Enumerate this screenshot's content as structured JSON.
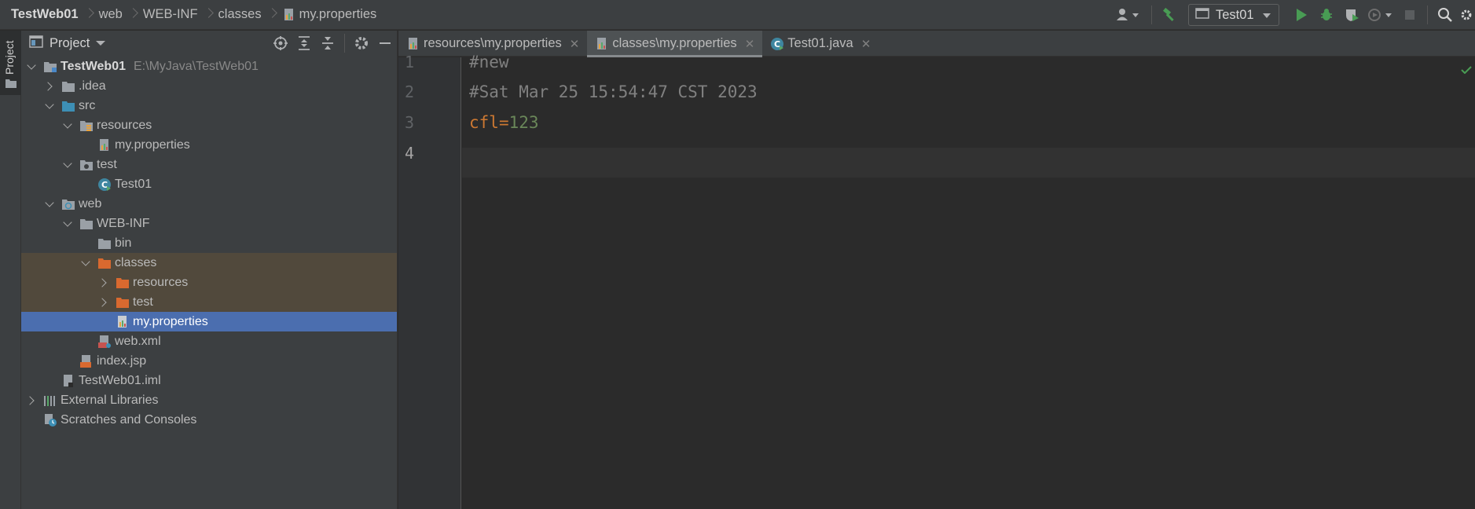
{
  "breadcrumbs": [
    "TestWeb01",
    "web",
    "WEB-INF",
    "classes",
    "my.properties"
  ],
  "run_config": {
    "label": "Test01"
  },
  "left_strip": {
    "label": "Project"
  },
  "project_panel": {
    "title": "Project"
  },
  "tree": [
    {
      "label": "TestWeb01",
      "path": "E:\\MyJava\\TestWeb01"
    },
    {
      "label": ".idea"
    },
    {
      "label": "src"
    },
    {
      "label": "resources"
    },
    {
      "label": "my.properties"
    },
    {
      "label": "test"
    },
    {
      "label": "Test01"
    },
    {
      "label": "web"
    },
    {
      "label": "WEB-INF"
    },
    {
      "label": "bin"
    },
    {
      "label": "classes"
    },
    {
      "label": "resources"
    },
    {
      "label": "test"
    },
    {
      "label": "my.properties"
    },
    {
      "label": "web.xml"
    },
    {
      "label": "index.jsp"
    },
    {
      "label": "TestWeb01.iml"
    },
    {
      "label": "External Libraries"
    },
    {
      "label": "Scratches and Consoles"
    }
  ],
  "tabs": [
    {
      "label": "resources\\my.properties",
      "active": false
    },
    {
      "label": "classes\\my.properties",
      "active": true
    },
    {
      "label": "Test01.java",
      "active": false
    }
  ],
  "editor": {
    "line_numbers": [
      "1",
      "2",
      "3",
      "4"
    ],
    "lines": {
      "l1": "#new",
      "l2": "#Sat Mar 25 15:54:47 CST 2023",
      "l3_key": "cfl",
      "l3_eq": "=",
      "l3_val": "123"
    }
  },
  "colors": {
    "selection": "#4b6eaf",
    "highlight": "#51493c",
    "comment": "#808080",
    "key": "#cc7832",
    "value": "#6a8759",
    "run_green": "#499c54"
  }
}
